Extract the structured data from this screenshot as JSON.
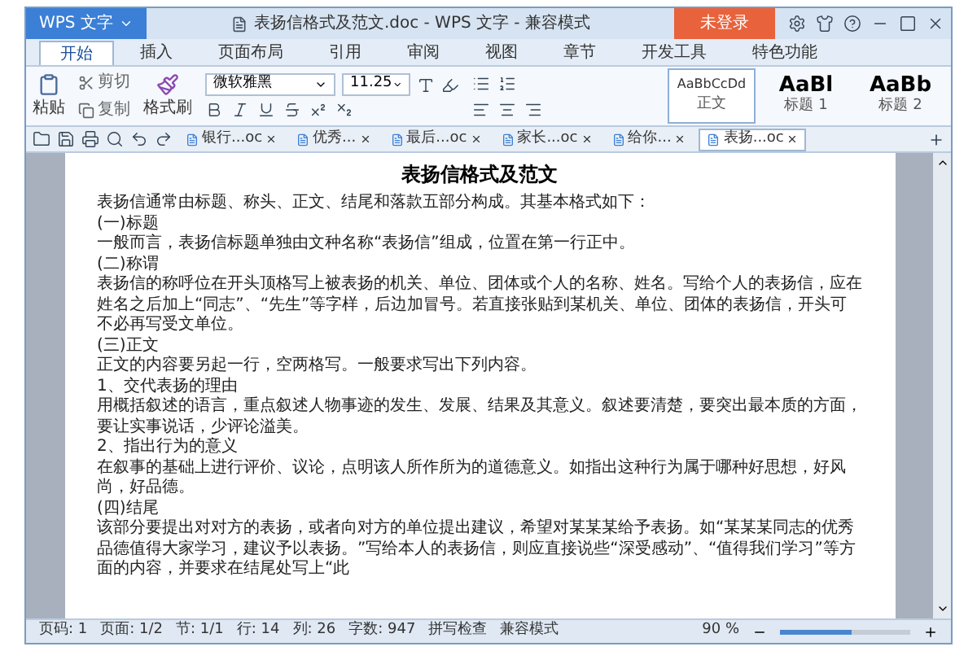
{
  "window": {
    "app_menu": "WPS 文字",
    "title": "表扬信格式及范文.doc - WPS 文字 - 兼容模式",
    "login_button": "未登录"
  },
  "ribbon_tabs": [
    {
      "label": "开始",
      "selected": true
    },
    {
      "label": "插入",
      "selected": false
    },
    {
      "label": "页面布局",
      "selected": false
    },
    {
      "label": "引用",
      "selected": false
    },
    {
      "label": "审阅",
      "selected": false
    },
    {
      "label": "视图",
      "selected": false
    },
    {
      "label": "章节",
      "selected": false
    },
    {
      "label": "开发工具",
      "selected": false
    },
    {
      "label": "特色功能",
      "selected": false
    }
  ],
  "ribbon": {
    "paste": "粘贴",
    "cut": "剪切",
    "copy": "复制",
    "format_painter": "格式刷",
    "font": "微软雅黑",
    "font_size": "11.25",
    "styles": [
      {
        "preview": "AaBbCcDd",
        "label": "正文",
        "selected": true
      },
      {
        "preview": "AaBl",
        "label": "标题 1",
        "selected": false
      },
      {
        "preview": "AaBb",
        "label": "标题 2",
        "selected": false
      }
    ]
  },
  "doc_tabs": [
    {
      "label": "银行...oc",
      "selected": false
    },
    {
      "label": "优秀...",
      "selected": false
    },
    {
      "label": "最后...oc",
      "selected": false
    },
    {
      "label": "家长...oc",
      "selected": false
    },
    {
      "label": "给你...",
      "selected": false
    },
    {
      "label": "表扬...oc",
      "selected": true
    }
  ],
  "document": {
    "title": "表扬信格式及范文",
    "paragraphs": [
      "表扬信通常由标题、称头、正文、结尾和落款五部分构成。其基本格式如下：",
      "(一)标题",
      "一般而言，表扬信标题单独由文种名称“表扬信”组成，位置在第一行正中。",
      "(二)称谓",
      "表扬信的称呼位在开头顶格写上被表扬的机关、单位、团体或个人的名称、姓名。写给个人的表扬信，应在姓名之后加上“同志”、“先生”等字样，后边加冒号。若直接张贴到某机关、单位、团体的表扬信，开头可不必再写受文单位。",
      "(三)正文",
      "正文的内容要另起一行，空两格写。一般要求写出下列内容。",
      "1、交代表扬的理由",
      "用概括叙述的语言，重点叙述人物事迹的发生、发展、结果及其意义。叙述要清楚，要突出最本质的方面，要让实事说话，少评论溢美。",
      "2、指出行为的意义",
      "在叙事的基础上进行评价、议论，点明该人所作所为的道德意义。如指出这种行为属于哪种好思想，好风尚，好品德。",
      "(四)结尾",
      "该部分要提出对对方的表扬，或者向对方的单位提出建议，希望对某某某给予表扬。如“某某某同志的优秀品德值得大家学习，建议予以表扬。”写给本人的表扬信，则应直接说些“深受感动”、“值得我们学习”等方面的内容，并要求在结尾处写上“此"
    ]
  },
  "status_bar": {
    "items": [
      "页码: 1",
      "页面: 1/2",
      "节: 1/1",
      "行: 14",
      "列: 26",
      "字数: 947",
      "拼写检查",
      "兼容模式"
    ],
    "zoom": "90 %",
    "level": 0.55
  }
}
